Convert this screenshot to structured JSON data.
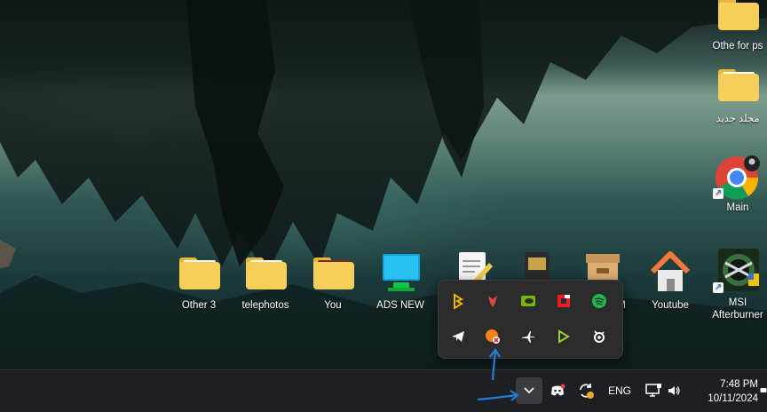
{
  "desktop": {
    "icons": [
      {
        "label": "Othe for ps",
        "icon": "folder-icon"
      },
      {
        "label": "مجلد جديد",
        "icon": "folder-icon"
      },
      {
        "label": "Main",
        "icon": "chrome-icon"
      },
      {
        "label": "MSI Afterburner",
        "icon": "msi-afterburner-icon"
      },
      {
        "label": "Other 3",
        "icon": "folder-icon"
      },
      {
        "label": "telephotos",
        "icon": "folder-icon"
      },
      {
        "label": "You",
        "icon": "folder-icon"
      },
      {
        "label": "ADS NEW",
        "icon": "monitor-icon"
      },
      {
        "label": "M",
        "icon": "archive-box-icon"
      },
      {
        "label": "Youtube",
        "icon": "home-icon"
      }
    ]
  },
  "tray_overflow": {
    "icons": [
      {
        "name": "bitdefender-icon",
        "color": "#f2b400"
      },
      {
        "name": "microphone-icon",
        "color": "#e04545"
      },
      {
        "name": "nvidia-icon",
        "color": "#76b900"
      },
      {
        "name": "amd-icon",
        "color": "#ed1c24"
      },
      {
        "name": "spotify-icon",
        "color": "#1db954"
      },
      {
        "name": "telegram-icon",
        "color": "#ffffff"
      },
      {
        "name": "update-warning-icon",
        "color": "#f58220"
      },
      {
        "name": "airplane-icon",
        "color": "#ffffff"
      },
      {
        "name": "media-player-icon",
        "color": "#9bd134"
      },
      {
        "name": "steelseries-icon",
        "color": "#ffffff"
      }
    ]
  },
  "taskbar": {
    "language": "ENG",
    "time": "7:48 PM",
    "date": "10/11/2024"
  },
  "colors": {
    "taskbar_bg": "#1d1f22",
    "flyout_bg": "#2c2c2c",
    "annotation_arrow": "#1e7fd8"
  }
}
